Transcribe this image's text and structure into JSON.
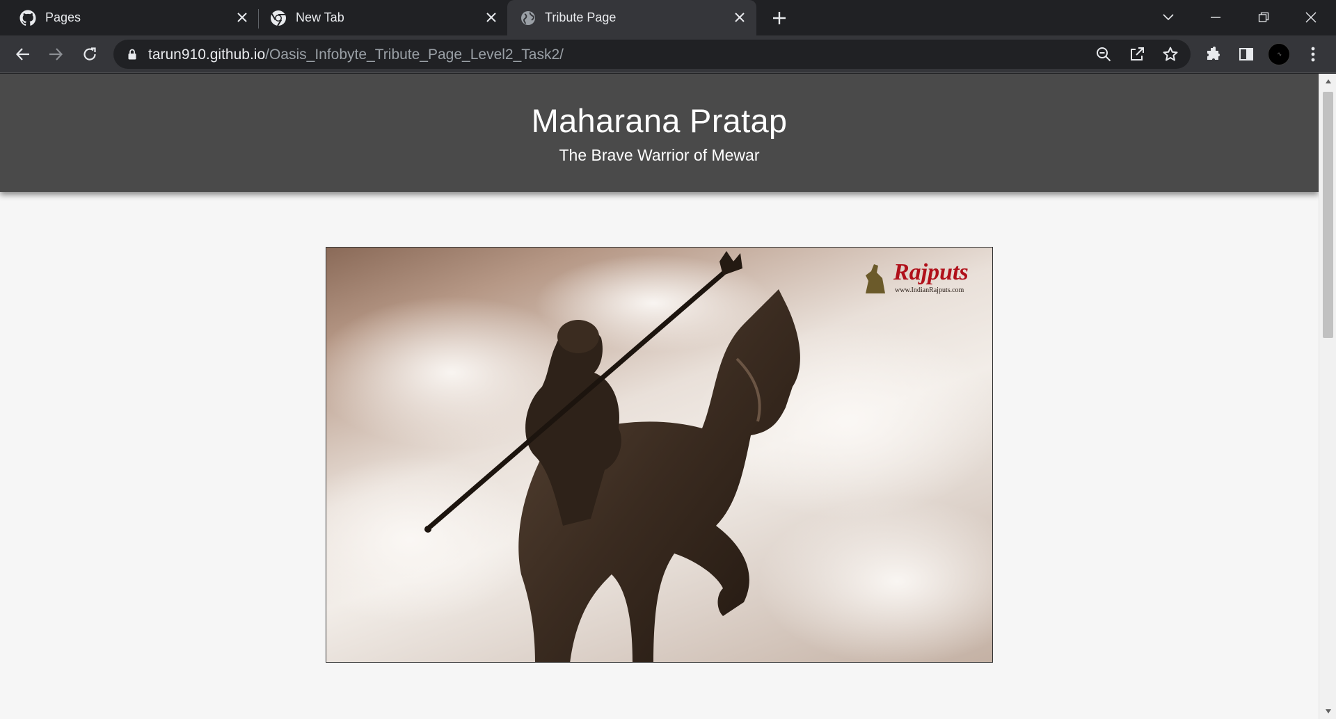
{
  "browser": {
    "tabs": [
      {
        "title": "Pages",
        "favicon": "github-icon",
        "active": false
      },
      {
        "title": "New Tab",
        "favicon": "chrome-icon",
        "active": false
      },
      {
        "title": "Tribute Page",
        "favicon": "globe-icon",
        "active": true
      }
    ],
    "address": {
      "host": "tarun910.github.io",
      "path": "/Oasis_Infobyte_Tribute_Page_Level2_Task2/"
    },
    "toolbar_icons": [
      "back-icon",
      "forward-icon",
      "reload-icon",
      "zoom-out-icon",
      "share-icon",
      "bookmark-star-icon",
      "extensions-icon",
      "side-panel-icon",
      "profile-avatar",
      "menu-icon"
    ]
  },
  "page": {
    "header": {
      "title": "Maharana Pratap",
      "subtitle": "The Brave Warrior of Mewar"
    },
    "hero_image": {
      "subject": "statue of Maharana Pratap on horseback",
      "watermark_brand": "Rajputs",
      "watermark_url": "www.IndianRajputs.com"
    }
  },
  "colors": {
    "tabstrip_bg": "#202124",
    "toolbar_bg": "#35363a",
    "header_bg": "#4a4a4a",
    "page_bg": "#f6f6f6",
    "watermark_red": "#b0101a"
  }
}
